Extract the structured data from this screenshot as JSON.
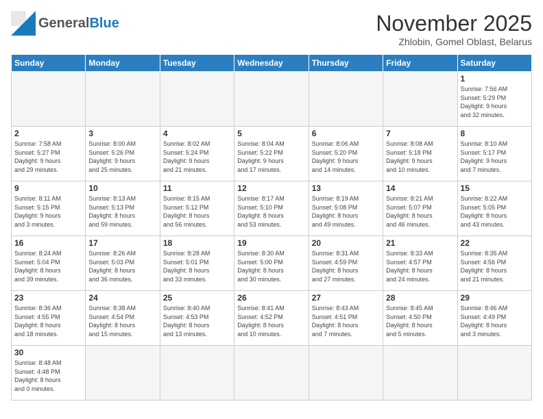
{
  "header": {
    "logo_general": "General",
    "logo_blue": "Blue",
    "month_title": "November 2025",
    "location": "Zhlobin, Gomel Oblast, Belarus"
  },
  "weekdays": [
    "Sunday",
    "Monday",
    "Tuesday",
    "Wednesday",
    "Thursday",
    "Friday",
    "Saturday"
  ],
  "weeks": [
    [
      {
        "day": "",
        "content": ""
      },
      {
        "day": "",
        "content": ""
      },
      {
        "day": "",
        "content": ""
      },
      {
        "day": "",
        "content": ""
      },
      {
        "day": "",
        "content": ""
      },
      {
        "day": "",
        "content": ""
      },
      {
        "day": "1",
        "content": "Sunrise: 7:56 AM\nSunset: 5:29 PM\nDaylight: 9 hours\nand 32 minutes."
      }
    ],
    [
      {
        "day": "2",
        "content": "Sunrise: 7:58 AM\nSunset: 5:27 PM\nDaylight: 9 hours\nand 29 minutes."
      },
      {
        "day": "3",
        "content": "Sunrise: 8:00 AM\nSunset: 5:26 PM\nDaylight: 9 hours\nand 25 minutes."
      },
      {
        "day": "4",
        "content": "Sunrise: 8:02 AM\nSunset: 5:24 PM\nDaylight: 9 hours\nand 21 minutes."
      },
      {
        "day": "5",
        "content": "Sunrise: 8:04 AM\nSunset: 5:22 PM\nDaylight: 9 hours\nand 17 minutes."
      },
      {
        "day": "6",
        "content": "Sunrise: 8:06 AM\nSunset: 5:20 PM\nDaylight: 9 hours\nand 14 minutes."
      },
      {
        "day": "7",
        "content": "Sunrise: 8:08 AM\nSunset: 5:18 PM\nDaylight: 9 hours\nand 10 minutes."
      },
      {
        "day": "8",
        "content": "Sunrise: 8:10 AM\nSunset: 5:17 PM\nDaylight: 9 hours\nand 7 minutes."
      }
    ],
    [
      {
        "day": "9",
        "content": "Sunrise: 8:11 AM\nSunset: 5:15 PM\nDaylight: 9 hours\nand 3 minutes."
      },
      {
        "day": "10",
        "content": "Sunrise: 8:13 AM\nSunset: 5:13 PM\nDaylight: 8 hours\nand 59 minutes."
      },
      {
        "day": "11",
        "content": "Sunrise: 8:15 AM\nSunset: 5:12 PM\nDaylight: 8 hours\nand 56 minutes."
      },
      {
        "day": "12",
        "content": "Sunrise: 8:17 AM\nSunset: 5:10 PM\nDaylight: 8 hours\nand 53 minutes."
      },
      {
        "day": "13",
        "content": "Sunrise: 8:19 AM\nSunset: 5:08 PM\nDaylight: 8 hours\nand 49 minutes."
      },
      {
        "day": "14",
        "content": "Sunrise: 8:21 AM\nSunset: 5:07 PM\nDaylight: 8 hours\nand 46 minutes."
      },
      {
        "day": "15",
        "content": "Sunrise: 8:22 AM\nSunset: 5:05 PM\nDaylight: 8 hours\nand 43 minutes."
      }
    ],
    [
      {
        "day": "16",
        "content": "Sunrise: 8:24 AM\nSunset: 5:04 PM\nDaylight: 8 hours\nand 39 minutes."
      },
      {
        "day": "17",
        "content": "Sunrise: 8:26 AM\nSunset: 5:03 PM\nDaylight: 8 hours\nand 36 minutes."
      },
      {
        "day": "18",
        "content": "Sunrise: 8:28 AM\nSunset: 5:01 PM\nDaylight: 8 hours\nand 33 minutes."
      },
      {
        "day": "19",
        "content": "Sunrise: 8:30 AM\nSunset: 5:00 PM\nDaylight: 8 hours\nand 30 minutes."
      },
      {
        "day": "20",
        "content": "Sunrise: 8:31 AM\nSunset: 4:59 PM\nDaylight: 8 hours\nand 27 minutes."
      },
      {
        "day": "21",
        "content": "Sunrise: 8:33 AM\nSunset: 4:57 PM\nDaylight: 8 hours\nand 24 minutes."
      },
      {
        "day": "22",
        "content": "Sunrise: 8:35 AM\nSunset: 4:56 PM\nDaylight: 8 hours\nand 21 minutes."
      }
    ],
    [
      {
        "day": "23",
        "content": "Sunrise: 8:36 AM\nSunset: 4:55 PM\nDaylight: 8 hours\nand 18 minutes."
      },
      {
        "day": "24",
        "content": "Sunrise: 8:38 AM\nSunset: 4:54 PM\nDaylight: 8 hours\nand 15 minutes."
      },
      {
        "day": "25",
        "content": "Sunrise: 8:40 AM\nSunset: 4:53 PM\nDaylight: 8 hours\nand 13 minutes."
      },
      {
        "day": "26",
        "content": "Sunrise: 8:41 AM\nSunset: 4:52 PM\nDaylight: 8 hours\nand 10 minutes."
      },
      {
        "day": "27",
        "content": "Sunrise: 8:43 AM\nSunset: 4:51 PM\nDaylight: 8 hours\nand 7 minutes."
      },
      {
        "day": "28",
        "content": "Sunrise: 8:45 AM\nSunset: 4:50 PM\nDaylight: 8 hours\nand 5 minutes."
      },
      {
        "day": "29",
        "content": "Sunrise: 8:46 AM\nSunset: 4:49 PM\nDaylight: 8 hours\nand 3 minutes."
      }
    ],
    [
      {
        "day": "30",
        "content": "Sunrise: 8:48 AM\nSunset: 4:48 PM\nDaylight: 8 hours\nand 0 minutes."
      },
      {
        "day": "",
        "content": ""
      },
      {
        "day": "",
        "content": ""
      },
      {
        "day": "",
        "content": ""
      },
      {
        "day": "",
        "content": ""
      },
      {
        "day": "",
        "content": ""
      },
      {
        "day": "",
        "content": ""
      }
    ]
  ]
}
